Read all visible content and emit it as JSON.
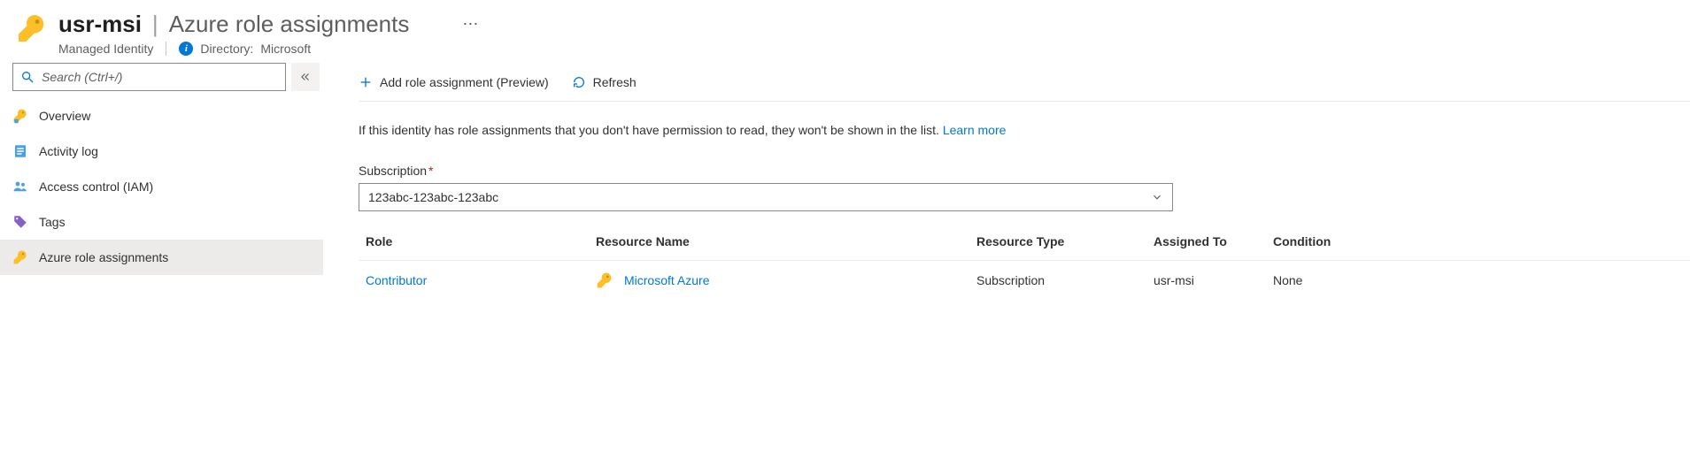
{
  "header": {
    "resource_name": "usr-msi",
    "section_title": "Azure role assignments",
    "resource_type": "Managed Identity",
    "directory_label": "Directory:",
    "directory_value": "Microsoft"
  },
  "sidebar": {
    "search_placeholder": "Search (Ctrl+/)",
    "items": [
      {
        "label": "Overview",
        "icon": "key"
      },
      {
        "label": "Activity log",
        "icon": "log"
      },
      {
        "label": "Access control (IAM)",
        "icon": "people"
      },
      {
        "label": "Tags",
        "icon": "tag"
      },
      {
        "label": "Azure role assignments",
        "icon": "key",
        "active": true
      }
    ]
  },
  "toolbar": {
    "add_label": "Add role assignment (Preview)",
    "refresh_label": "Refresh"
  },
  "notice": {
    "text": "If this identity has role assignments that you don't have permission to read, they won't be shown in the list.",
    "link_text": "Learn more"
  },
  "subscription": {
    "label": "Subscription",
    "value": "123abc-123abc-123abc"
  },
  "table": {
    "columns": [
      "Role",
      "Resource Name",
      "Resource Type",
      "Assigned To",
      "Condition"
    ],
    "rows": [
      {
        "role": "Contributor",
        "resource_name": "Microsoft Azure",
        "resource_type": "Subscription",
        "assigned_to": "usr-msi",
        "condition": "None"
      }
    ]
  }
}
